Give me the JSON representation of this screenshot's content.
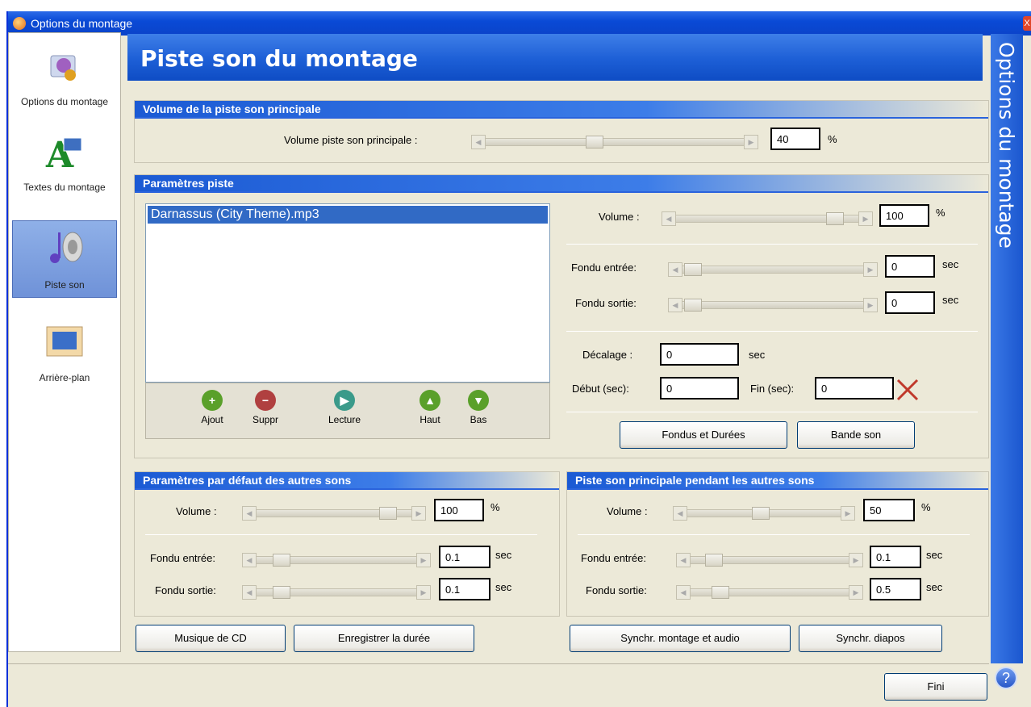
{
  "window": {
    "title": "Options du montage",
    "close_label": "X"
  },
  "sidebar": {
    "items": [
      {
        "label": "Options du montage",
        "icon": "montage-options-icon"
      },
      {
        "label": "Textes du montage",
        "icon": "text-icon"
      },
      {
        "label": "Piste son",
        "icon": "music-speaker-icon",
        "active": true
      },
      {
        "label": "Arrière-plan",
        "icon": "background-image-icon"
      }
    ]
  },
  "header": {
    "title": "Piste son du montage"
  },
  "vertical_title": "Options du montage",
  "main_volume": {
    "heading": "Volume de la piste son principale",
    "label": "Volume piste son principale :",
    "value": "40",
    "unit": "%"
  },
  "track": {
    "heading": "Paramètres piste",
    "files": [
      "Darnassus (City Theme).mp3"
    ],
    "tools": {
      "add": "Ajout",
      "remove": "Suppr",
      "play": "Lecture",
      "up": "Haut",
      "down": "Bas"
    },
    "volume_label": "Volume :",
    "volume_value": "100",
    "volume_unit": "%",
    "fade_in_label": "Fondu entrée:",
    "fade_in_value": "0",
    "fade_out_label": "Fondu sortie:",
    "fade_out_value": "0",
    "sec_unit": "sec",
    "offset_label": "Décalage :",
    "offset_value": "0",
    "start_label": "Début (sec):",
    "start_value": "0",
    "end_label": "Fin (sec):",
    "end_value": "0",
    "fades_button": "Fondus et Durées",
    "soundtrack_button": "Bande son"
  },
  "defaults": {
    "heading": "Paramètres par défaut des autres sons",
    "volume_label": "Volume :",
    "volume_value": "100",
    "volume_unit": "%",
    "fade_in_label": "Fondu entrée:",
    "fade_in_value": "0.1",
    "fade_out_label": "Fondu sortie:",
    "fade_out_value": "0.1",
    "sec_unit": "sec"
  },
  "during": {
    "heading": "Piste son principale pendant les autres sons",
    "volume_label": "Volume :",
    "volume_value": "50",
    "volume_unit": "%",
    "fade_in_label": "Fondu entrée:",
    "fade_in_value": "0.1",
    "fade_out_label": "Fondu sortie:",
    "fade_out_value": "0.5",
    "sec_unit": "sec"
  },
  "buttons": {
    "cd_music": "Musique de CD",
    "record_duration": "Enregistrer la durée",
    "sync_show_audio": "Synchr. montage et audio",
    "sync_slides": "Synchr. diapos",
    "done": "Fini"
  },
  "help_icon": "?",
  "colors": {
    "accent": "#1d5fd6",
    "selection": "#316ac5",
    "window_bg": "#ece9d8"
  }
}
